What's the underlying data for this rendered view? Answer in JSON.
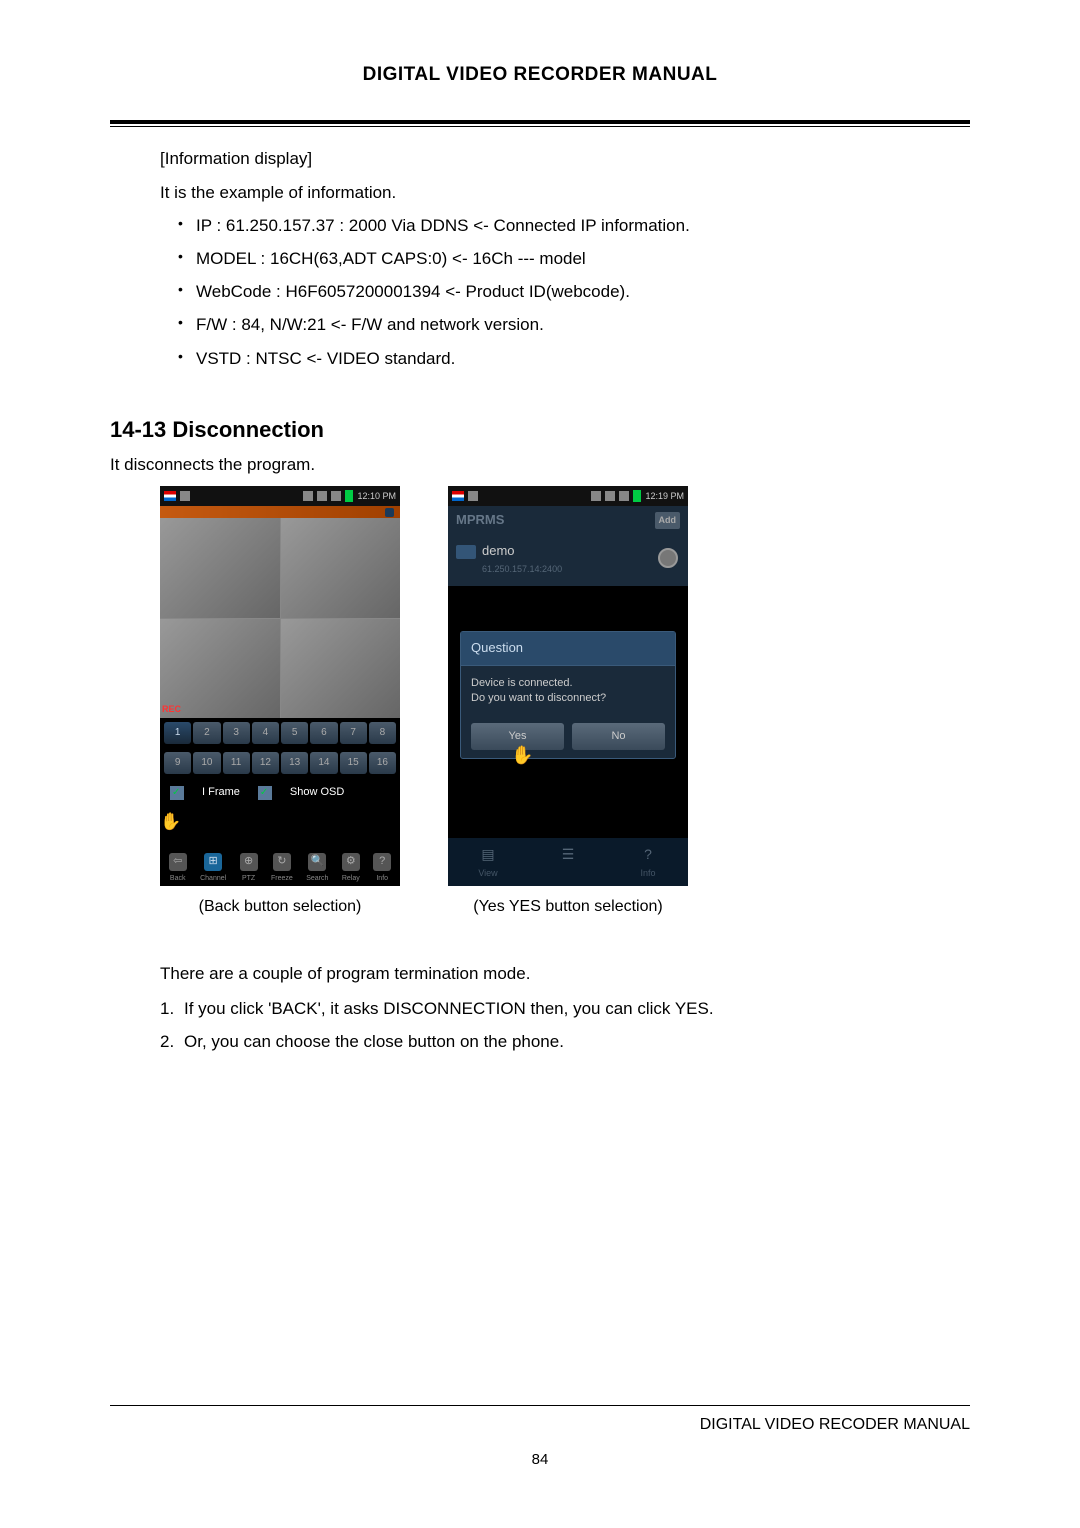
{
  "header": "DIGITAL VIDEO RECORDER MANUAL",
  "info": {
    "title": "[Information display]",
    "desc": "It is the example of information.",
    "items": [
      "IP : 61.250.157.37 : 2000 Via DDNS   <- Connected IP information.",
      "MODEL : 16CH(63,ADT CAPS:0) <- 16Ch --- model",
      "WebCode : H6F6057200001394 <- Product ID(webcode).",
      "F/W : 84, N/W:21   <- F/W and network version.",
      "VSTD : NTSC <- VIDEO standard."
    ]
  },
  "section": {
    "title": "14-13 Disconnection",
    "desc": "It disconnects the program."
  },
  "phone1": {
    "time": "12:10 PM",
    "rec": "REC",
    "channels_row1": [
      "1",
      "2",
      "3",
      "4",
      "5",
      "6",
      "7",
      "8"
    ],
    "channels_row2": [
      "9",
      "10",
      "11",
      "12",
      "13",
      "14",
      "15",
      "16"
    ],
    "opt1": "I Frame",
    "opt2": "Show OSD",
    "bottom": [
      "Back",
      "Channel",
      "PTZ",
      "Freeze",
      "Search",
      "Relay",
      "Info"
    ]
  },
  "phone2": {
    "time": "12:19 PM",
    "app": "MPRMS",
    "add": "Add",
    "device_name": "demo",
    "device_ip": "61.250.157.14:2400",
    "dialog_title": "Question",
    "dialog_line1": "Device is connected.",
    "dialog_line2": "Do you want to disconnect?",
    "yes": "Yes",
    "no": "No",
    "nav": [
      "View",
      "",
      "Info"
    ]
  },
  "captions": {
    "left": "(Back button selection)",
    "right": "(Yes YES button selection)"
  },
  "term": {
    "desc": "There are a couple of program termination mode.",
    "items": [
      {
        "num": "1.",
        "text": "If you click 'BACK', it asks DISCONNECTION then, you can click YES."
      },
      {
        "num": "2.",
        "text": "Or, you can choose the close button on the phone."
      }
    ]
  },
  "footer": "DIGITAL VIDEO RECODER MANUAL",
  "page": "84"
}
